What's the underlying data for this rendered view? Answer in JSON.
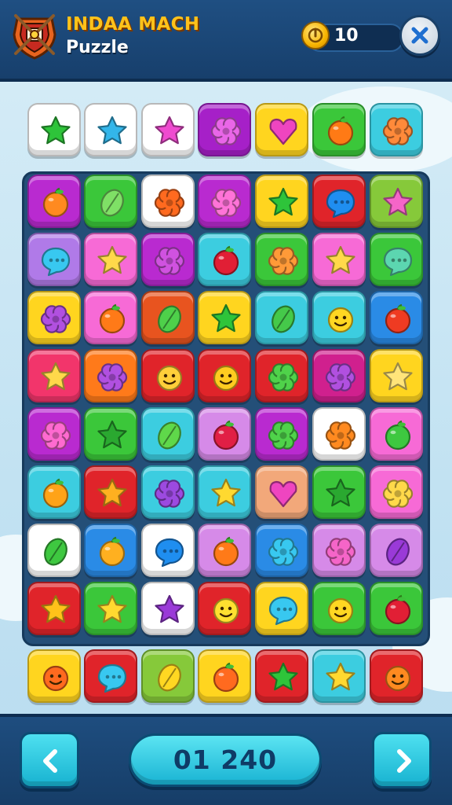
{
  "header": {
    "title": "INDAA MACH",
    "subtitle": "Puzzle",
    "coin_count": "10",
    "close_icon": "close-icon",
    "logo_icon": "shield-logo-icon",
    "coin_icon": "coin-icon"
  },
  "footer": {
    "score": "01 240",
    "prev_icon": "chevron-left-icon",
    "next_icon": "chevron-right-icon"
  },
  "colors": {
    "header_bg": "#1f4f82",
    "board_bg": "#244f78",
    "accent_cyan": "#2cc8e0",
    "gold": "#ffc21a"
  },
  "goal_tiles": [
    {
      "icon": "star",
      "bg": "#ffffff",
      "fg": "#2ec43a"
    },
    {
      "icon": "star",
      "bg": "#ffffff",
      "fg": "#33b6ea"
    },
    {
      "icon": "star",
      "bg": "#ffffff",
      "fg": "#ef4bd0"
    },
    {
      "icon": "flower",
      "bg": "#a620c8",
      "fg": "#e966e8"
    },
    {
      "icon": "heart",
      "bg": "#ffd51f",
      "fg": "#ef45c0"
    },
    {
      "icon": "fruit",
      "bg": "#3bc73a",
      "fg": "#ff7a15"
    },
    {
      "icon": "flower",
      "bg": "#3ccde0",
      "fg": "#ff8a3a"
    }
  ],
  "board_grid": [
    [
      {
        "icon": "fruit",
        "bg": "#b92ad0",
        "fg": "#ff8a20"
      },
      {
        "icon": "leaf",
        "bg": "#3bc73a",
        "fg": "#7fe066"
      },
      {
        "icon": "flower",
        "bg": "#ffffff",
        "fg": "#ff6a1f"
      },
      {
        "icon": "flower",
        "bg": "#b92ad0",
        "fg": "#ff73d8"
      },
      {
        "icon": "star",
        "bg": "#ffd51f",
        "fg": "#2ec43a"
      },
      {
        "icon": "bubble",
        "bg": "#e0242a",
        "fg": "#1f8ef0"
      },
      {
        "icon": "star",
        "bg": "#86c93a",
        "fg": "#f565c8"
      }
    ],
    [
      {
        "icon": "bubble",
        "bg": "#b07ae8",
        "fg": "#38c8f0"
      },
      {
        "icon": "star",
        "bg": "#f76ad6",
        "fg": "#ffd94a"
      },
      {
        "icon": "flower",
        "bg": "#b92ad0",
        "fg": "#d052e0"
      },
      {
        "icon": "fruit",
        "bg": "#3ccde0",
        "fg": "#e11f35"
      },
      {
        "icon": "flower",
        "bg": "#3bc73a",
        "fg": "#ff9a38"
      },
      {
        "icon": "star",
        "bg": "#f76ad6",
        "fg": "#ffd94a"
      },
      {
        "icon": "bubble",
        "bg": "#3bc73a",
        "fg": "#5cd6b0"
      }
    ],
    [
      {
        "icon": "flower",
        "bg": "#ffd51f",
        "fg": "#b150e0"
      },
      {
        "icon": "fruit",
        "bg": "#f76ad6",
        "fg": "#ff7a18"
      },
      {
        "icon": "leaf",
        "bg": "#e8541f",
        "fg": "#4ed04a"
      },
      {
        "icon": "star",
        "bg": "#ffd51f",
        "fg": "#2ec43a"
      },
      {
        "icon": "leaf",
        "bg": "#3ccde0",
        "fg": "#45c94a"
      },
      {
        "icon": "smiley",
        "bg": "#3ccde0",
        "fg": "#ffd722"
      },
      {
        "icon": "fruit",
        "bg": "#2a8be6",
        "fg": "#ef3b22"
      }
    ],
    [
      {
        "icon": "star",
        "bg": "#f2356b",
        "fg": "#ffd94a"
      },
      {
        "icon": "flower",
        "bg": "#ff7a1a",
        "fg": "#b150e0"
      },
      {
        "icon": "smiley",
        "bg": "#e0242a",
        "fg": "#ffcf3a"
      },
      {
        "icon": "smiley",
        "bg": "#e0242a",
        "fg": "#ffcc20"
      },
      {
        "icon": "flower",
        "bg": "#e0242a",
        "fg": "#4fd24a"
      },
      {
        "icon": "flower",
        "bg": "#d0208e",
        "fg": "#b150e0"
      },
      {
        "icon": "star",
        "bg": "#ffd51f",
        "fg": "#ffe47a"
      }
    ],
    [
      {
        "icon": "flower",
        "bg": "#b92ad0",
        "fg": "#ff6ad0"
      },
      {
        "icon": "star",
        "bg": "#3bc73a",
        "fg": "#2aa830"
      },
      {
        "icon": "leaf",
        "bg": "#3ccde0",
        "fg": "#5fd84a"
      },
      {
        "icon": "fruit",
        "bg": "#d68ae8",
        "fg": "#e11f45"
      },
      {
        "icon": "flower",
        "bg": "#b92ad0",
        "fg": "#4fd24a"
      },
      {
        "icon": "flower",
        "bg": "#ffffff",
        "fg": "#ff8a20"
      },
      {
        "icon": "fruit",
        "bg": "#f76ad6",
        "fg": "#3ec840"
      }
    ],
    [
      {
        "icon": "fruit",
        "bg": "#3ccde0",
        "fg": "#ffa318"
      },
      {
        "icon": "star",
        "bg": "#e0242a",
        "fg": "#ffb020"
      },
      {
        "icon": "flower",
        "bg": "#3ccde0",
        "fg": "#9c4ae0"
      },
      {
        "icon": "star",
        "bg": "#3ccde0",
        "fg": "#ffd930"
      },
      {
        "icon": "heart",
        "bg": "#f2a87a",
        "fg": "#ef45c0"
      },
      {
        "icon": "star",
        "bg": "#3bc73a",
        "fg": "#2aa830"
      },
      {
        "icon": "flower",
        "bg": "#f76ad6",
        "fg": "#ffd94a"
      }
    ],
    [
      {
        "icon": "leaf",
        "bg": "#ffffff",
        "fg": "#3ec840"
      },
      {
        "icon": "fruit",
        "bg": "#2a8be6",
        "fg": "#ffb020"
      },
      {
        "icon": "bubble",
        "bg": "#ffffff",
        "fg": "#1f8ef0"
      },
      {
        "icon": "fruit",
        "bg": "#d68ae8",
        "fg": "#ff7a18"
      },
      {
        "icon": "flower",
        "bg": "#2a8be6",
        "fg": "#38c8f0"
      },
      {
        "icon": "flower",
        "bg": "#d68ae8",
        "fg": "#f565c8"
      },
      {
        "icon": "leaf",
        "bg": "#d68ae8",
        "fg": "#9a3ad8"
      }
    ],
    [
      {
        "icon": "star",
        "bg": "#e0242a",
        "fg": "#ffc21a"
      },
      {
        "icon": "star",
        "bg": "#3bc73a",
        "fg": "#ffd930"
      },
      {
        "icon": "star",
        "bg": "#ffffff",
        "fg": "#9a3ad8"
      },
      {
        "icon": "smiley",
        "bg": "#e0242a",
        "fg": "#ffe030"
      },
      {
        "icon": "bubble",
        "bg": "#ffd51f",
        "fg": "#38c8f0"
      },
      {
        "icon": "smiley",
        "bg": "#3bc73a",
        "fg": "#ffd722"
      },
      {
        "icon": "fruit",
        "bg": "#3bc73a",
        "fg": "#e11f35"
      }
    ]
  ],
  "bottom_tiles": [
    {
      "icon": "smiley",
      "bg": "#ffd51f",
      "fg": "#ff6a1f"
    },
    {
      "icon": "bubble",
      "bg": "#e0242a",
      "fg": "#38c8f0"
    },
    {
      "icon": "leaf",
      "bg": "#86c93a",
      "fg": "#ffd722"
    },
    {
      "icon": "fruit",
      "bg": "#ffd51f",
      "fg": "#ff6a1f"
    },
    {
      "icon": "star",
      "bg": "#e0242a",
      "fg": "#2ec43a"
    },
    {
      "icon": "star",
      "bg": "#3ccde0",
      "fg": "#ffd930"
    },
    {
      "icon": "smiley",
      "bg": "#e0242a",
      "fg": "#ff8a20"
    }
  ]
}
